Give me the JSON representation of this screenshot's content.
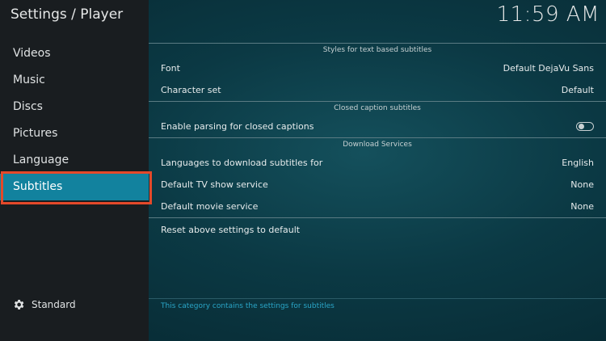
{
  "window_title": "Settings / Player",
  "clock": "11:59 AM",
  "sidebar": {
    "items": [
      {
        "label": "Videos"
      },
      {
        "label": "Music"
      },
      {
        "label": "Discs"
      },
      {
        "label": "Pictures"
      },
      {
        "label": "Language"
      },
      {
        "label": "Subtitles",
        "active": true
      }
    ],
    "level_label": "Standard"
  },
  "sections": {
    "text_subs": {
      "header": "Styles for text based subtitles",
      "font_label": "Font",
      "font_value": "Default DejaVu Sans",
      "charset_label": "Character set",
      "charset_value": "Default"
    },
    "closed_caption": {
      "header": "Closed caption subtitles",
      "parsing_label": "Enable parsing for closed captions",
      "parsing_enabled": false
    },
    "download": {
      "header": "Download Services",
      "languages_label": "Languages to download subtitles for",
      "languages_value": "English",
      "tv_label": "Default TV show service",
      "tv_value": "None",
      "movie_label": "Default movie service",
      "movie_value": "None"
    }
  },
  "reset_label": "Reset above settings to default",
  "footer_text": "This category contains the settings for subtitles",
  "colors": {
    "accent": "#12829e",
    "highlight_outline": "#e4492a",
    "footer_text": "#2aa6c8"
  }
}
